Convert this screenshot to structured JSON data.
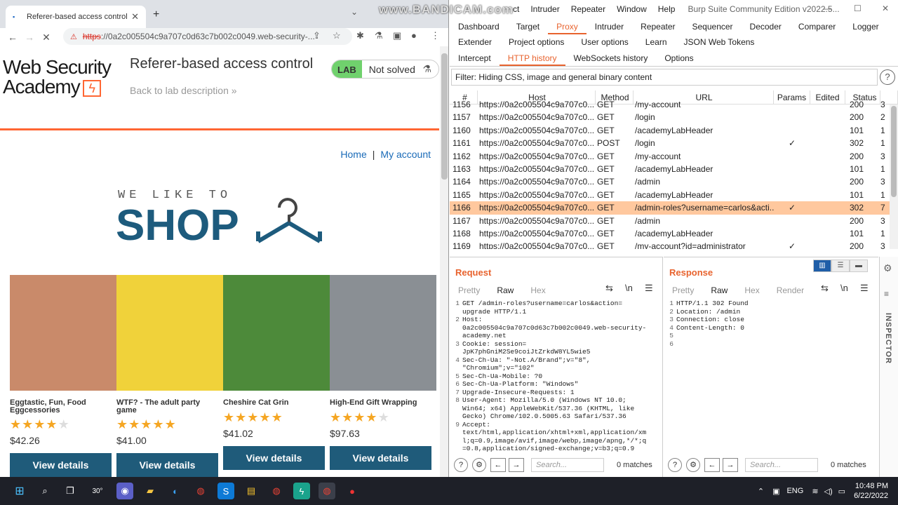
{
  "browser": {
    "tab_title": "Referer-based access control",
    "address_proto": "https",
    "address_rest": "://0a2c005504c9a707c0d63c7b002c0049.web-security-...",
    "page": {
      "logo_line1": "Web Security",
      "logo_line2": "Academy",
      "lab_title": "Referer-based access control",
      "back_link": "Back to lab description",
      "lab_badge": "LAB",
      "lab_status": "Not solved",
      "nav_home": "Home",
      "nav_sep": "|",
      "nav_account": "My account",
      "hero_small": "WE LIKE TO",
      "hero_big": "SHOP",
      "products": [
        {
          "name": "Eggtastic, Fun, Food Eggcessories",
          "rating": 4,
          "price": "$42.26",
          "button": "View details",
          "img_bg": "#c98a6a"
        },
        {
          "name": "WTF? - The adult party game",
          "rating": 5,
          "price": "$41.00",
          "button": "View details",
          "img_bg": "#f0d23a"
        },
        {
          "name": "Cheshire Cat Grin",
          "rating": 5,
          "price": "$41.02",
          "button": "View details",
          "img_bg": "#4d8a3a"
        },
        {
          "name": "High-End Gift Wrapping",
          "rating": 4,
          "price": "$97.63",
          "button": "View details",
          "img_bg": "#8a8f94"
        }
      ]
    }
  },
  "watermark": "www.BANDICAM.com",
  "burp": {
    "menu": [
      "ct",
      "Intruder",
      "Repeater",
      "Window",
      "Help"
    ],
    "window_title": "Burp Suite Community Edition v2022.5...",
    "tabs_row1": [
      "Dashboard",
      "Target",
      "Proxy",
      "Intruder",
      "Repeater",
      "Sequencer",
      "Decoder",
      "Comparer",
      "Logger"
    ],
    "tabs_row2": [
      "Extender",
      "Project options",
      "User options",
      "Learn",
      "JSON Web Tokens"
    ],
    "subtabs": [
      "Intercept",
      "HTTP history",
      "WebSockets history",
      "Options"
    ],
    "filter": "Filter: Hiding CSS, image and general binary content",
    "columns": [
      "#",
      "Host",
      "Method",
      "URL",
      "Params",
      "Edited",
      "Status",
      ""
    ],
    "rows": [
      {
        "n": "1156",
        "host": "https://0a2c005504c9a707c0...",
        "method": "GET",
        "url": "/my-account",
        "params": "",
        "status": "200",
        "len": "3"
      },
      {
        "n": "1157",
        "host": "https://0a2c005504c9a707c0...",
        "method": "GET",
        "url": "/login",
        "params": "",
        "status": "200",
        "len": "2"
      },
      {
        "n": "1160",
        "host": "https://0a2c005504c9a707c0...",
        "method": "GET",
        "url": "/academyLabHeader",
        "params": "",
        "status": "101",
        "len": "1"
      },
      {
        "n": "1161",
        "host": "https://0a2c005504c9a707c0...",
        "method": "POST",
        "url": "/login",
        "params": "✓",
        "status": "302",
        "len": "1"
      },
      {
        "n": "1162",
        "host": "https://0a2c005504c9a707c0...",
        "method": "GET",
        "url": "/my-account",
        "params": "",
        "status": "200",
        "len": "3"
      },
      {
        "n": "1163",
        "host": "https://0a2c005504c9a707c0...",
        "method": "GET",
        "url": "/academyLabHeader",
        "params": "",
        "status": "101",
        "len": "1"
      },
      {
        "n": "1164",
        "host": "https://0a2c005504c9a707c0...",
        "method": "GET",
        "url": "/admin",
        "params": "",
        "status": "200",
        "len": "3"
      },
      {
        "n": "1165",
        "host": "https://0a2c005504c9a707c0...",
        "method": "GET",
        "url": "/academyLabHeader",
        "params": "",
        "status": "101",
        "len": "1"
      },
      {
        "n": "1166",
        "host": "https://0a2c005504c9a707c0...",
        "method": "GET",
        "url": "/admin-roles?username=carlos&acti...",
        "params": "✓",
        "status": "302",
        "len": "7"
      },
      {
        "n": "1167",
        "host": "https://0a2c005504c9a707c0...",
        "method": "GET",
        "url": "/admin",
        "params": "",
        "status": "200",
        "len": "3"
      },
      {
        "n": "1168",
        "host": "https://0a2c005504c9a707c0...",
        "method": "GET",
        "url": "/academyLabHeader",
        "params": "",
        "status": "101",
        "len": "1"
      },
      {
        "n": "1169",
        "host": "https://0a2c005504c9a707c0...",
        "method": "GET",
        "url": "/my-account?id=administrator",
        "params": "✓",
        "status": "200",
        "len": "3"
      }
    ],
    "selected_row": "1166",
    "request": {
      "title": "Request",
      "tabs": [
        "Pretty",
        "Raw",
        "Hex"
      ],
      "active_tab": "Raw",
      "lines": [
        [
          "1",
          "GET /admin-roles?username=carlos&action="
        ],
        [
          "",
          "upgrade HTTP/1.1"
        ],
        [
          "2",
          "Host:"
        ],
        [
          "",
          "0a2c005504c9a707c0d63c7b002c0049.web-security-"
        ],
        [
          "",
          "academy.net"
        ],
        [
          "3",
          "Cookie: session="
        ],
        [
          "",
          "JpK7phGniM2Se9coiJtZrkdW8YL5wie5"
        ],
        [
          "4",
          "Sec-Ch-Ua: \"-Not.A/Brand\";v=\"8\","
        ],
        [
          "",
          "\"Chromium\";v=\"102\""
        ],
        [
          "5",
          "Sec-Ch-Ua-Mobile: ?0"
        ],
        [
          "6",
          "Sec-Ch-Ua-Platform: \"Windows\""
        ],
        [
          "7",
          "Upgrade-Insecure-Requests: 1"
        ],
        [
          "8",
          "User-Agent: Mozilla/5.0 (Windows NT 10.0;"
        ],
        [
          "",
          "Win64; x64) AppleWebKit/537.36 (KHTML, like"
        ],
        [
          "",
          "Gecko) Chrome/102.0.5005.63 Safari/537.36"
        ],
        [
          "9",
          "Accept:"
        ],
        [
          "",
          "text/html,application/xhtml+xml,application/xm"
        ],
        [
          "",
          "l;q=0.9,image/avif,image/webp,image/apng,*/*;q"
        ],
        [
          "",
          "=0.8,application/signed-exchange;v=b3;q=0.9"
        ]
      ],
      "search_placeholder": "Search...",
      "matches": "0 matches"
    },
    "response": {
      "title": "Response",
      "tabs": [
        "Pretty",
        "Raw",
        "Hex",
        "Render"
      ],
      "active_tab": "Raw",
      "lines": [
        [
          "1",
          "HTTP/1.1 302 Found"
        ],
        [
          "2",
          "Location: /admin"
        ],
        [
          "3",
          "Connection: close"
        ],
        [
          "4",
          "Content-Length: 0"
        ],
        [
          "5",
          ""
        ],
        [
          "6",
          ""
        ]
      ],
      "search_placeholder": "Search...",
      "matches": "0 matches"
    },
    "inspector_label": "INSPECTOR"
  },
  "taskbar": {
    "weather": "30°",
    "lang": "ENG",
    "time": "10:48 PM",
    "date": "6/22/2022"
  },
  "colors": {
    "burp_accent": "#e8632e",
    "selected_row": "#ffc89e",
    "wsa_orange": "#ff6633",
    "view_btn": "#1f5b7a"
  }
}
